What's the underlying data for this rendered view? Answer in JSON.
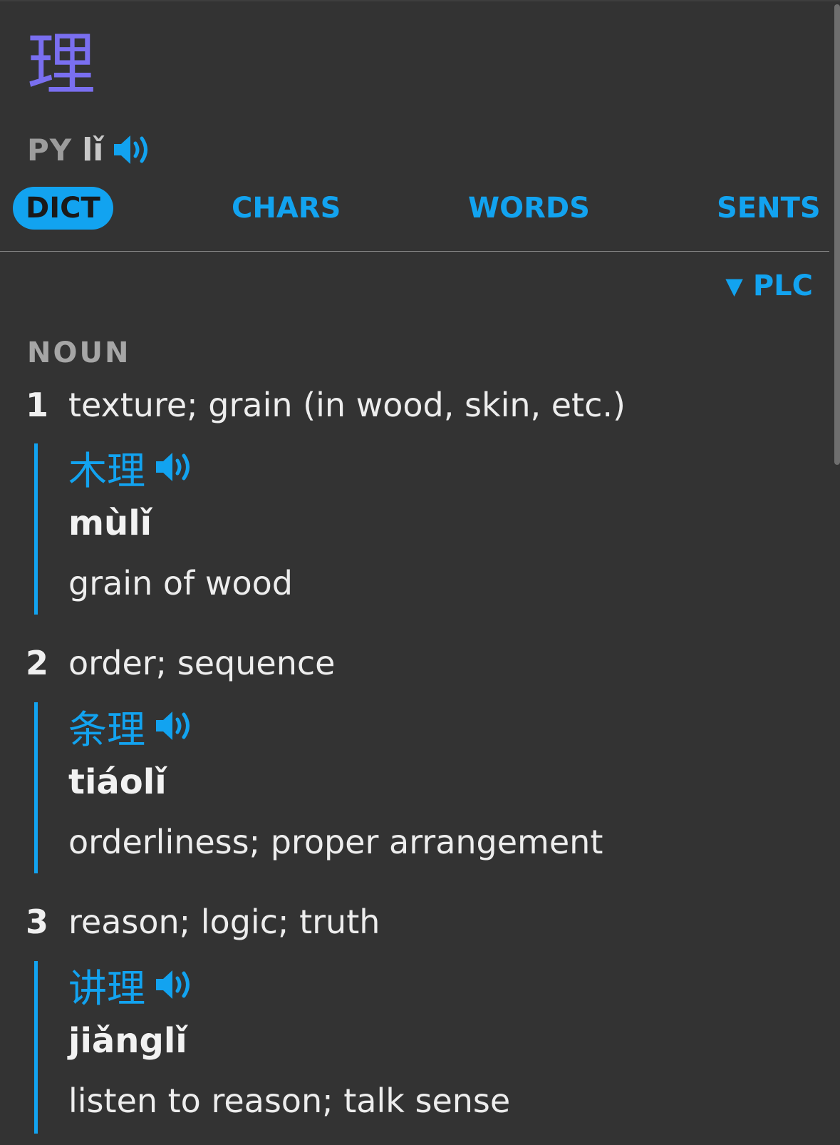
{
  "entry": {
    "headword": "理",
    "pinyin_label": "PY",
    "pinyin": "lǐ"
  },
  "tabs": [
    {
      "label": "DICT",
      "active": true
    },
    {
      "label": "CHARS",
      "active": false
    },
    {
      "label": "WORDS",
      "active": false
    },
    {
      "label": "SENTS",
      "active": false
    }
  ],
  "source_toggle": {
    "glyph": "▼",
    "label": "PLC"
  },
  "part_of_speech": "NOUN",
  "senses": [
    {
      "number": "1",
      "definition": "texture; grain (in wood, skin, etc.)",
      "example": {
        "hanzi": "木理",
        "pinyin": "mùlǐ",
        "gloss": "grain of wood"
      }
    },
    {
      "number": "2",
      "definition": "order; sequence",
      "example": {
        "hanzi": "条理",
        "pinyin": "tiáolǐ",
        "gloss": "orderliness; proper arrangement"
      }
    },
    {
      "number": "3",
      "definition": "reason; logic; truth",
      "example": {
        "hanzi": "讲理",
        "pinyin": "jiǎnglǐ",
        "gloss": "listen to reason; talk sense"
      }
    }
  ],
  "icons": {
    "audio": "speaker-icon"
  },
  "colors": {
    "background": "#333333",
    "accent": "#12a3f0",
    "headword": "#7a6ff0",
    "muted_label": "#9c9c9c"
  }
}
